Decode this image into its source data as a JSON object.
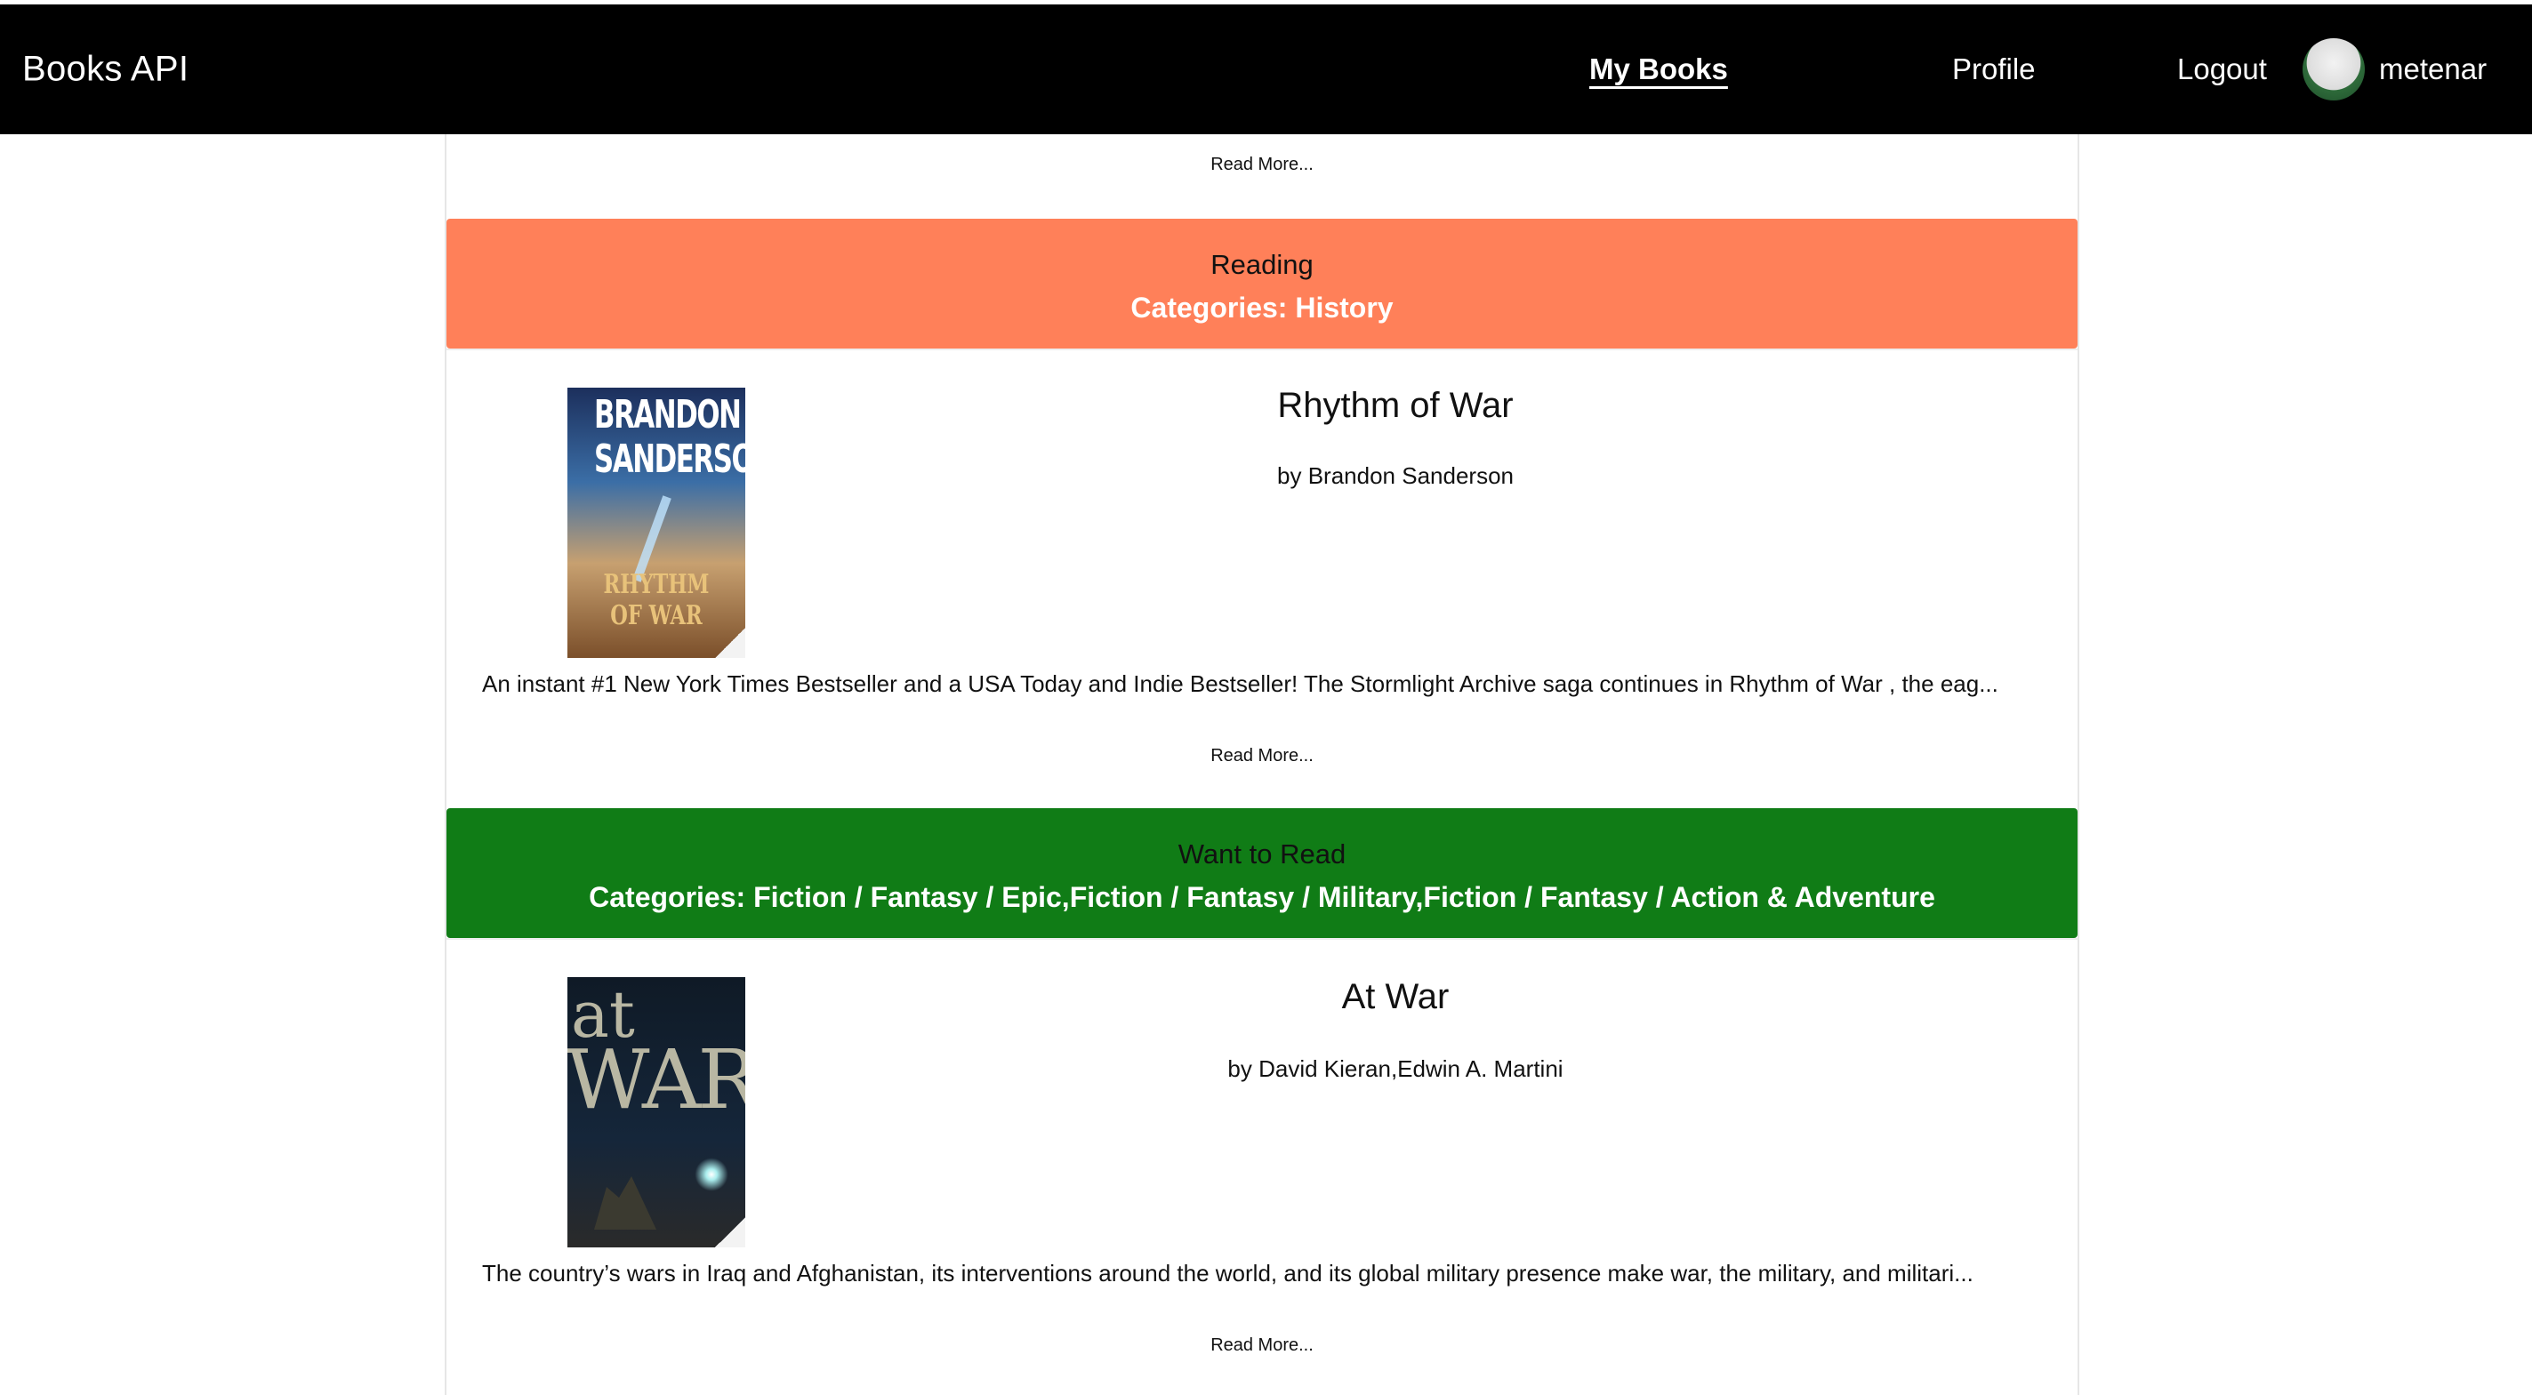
{
  "navbar": {
    "brand": "Books API",
    "links": {
      "my_books": "My Books",
      "profile": "Profile",
      "logout": "Logout"
    },
    "username": "metenar"
  },
  "top_read_more": "Read More...",
  "sections": [
    {
      "status": "Reading",
      "categories": "Categories: History",
      "color": "#ff8059",
      "book": {
        "title": "Rhythm of War",
        "author": "by Brandon Sanderson",
        "cover_author": "BRANDON SANDERSON",
        "cover_title": "RHYTHM OF WAR",
        "description": "An instant #1 New York Times Bestseller and a USA Today and Indie Bestseller! The Stormlight Archive saga continues in Rhythm of War , the eag...",
        "read_more": "Read More..."
      }
    },
    {
      "status": "Want to Read",
      "categories": "Categories: Fiction / Fantasy / Epic,Fiction / Fantasy / Military,Fiction / Fantasy / Action & Adventure",
      "color": "#107c16",
      "book": {
        "title": "At War",
        "author": "by David Kieran,Edwin A. Martini",
        "cover_at": "at",
        "cover_war": "WAR",
        "description": "The country’s wars in Iraq and Afghanistan, its interventions around the world, and its global military presence make war, the military, and militari...",
        "read_more": "Read More..."
      }
    }
  ]
}
